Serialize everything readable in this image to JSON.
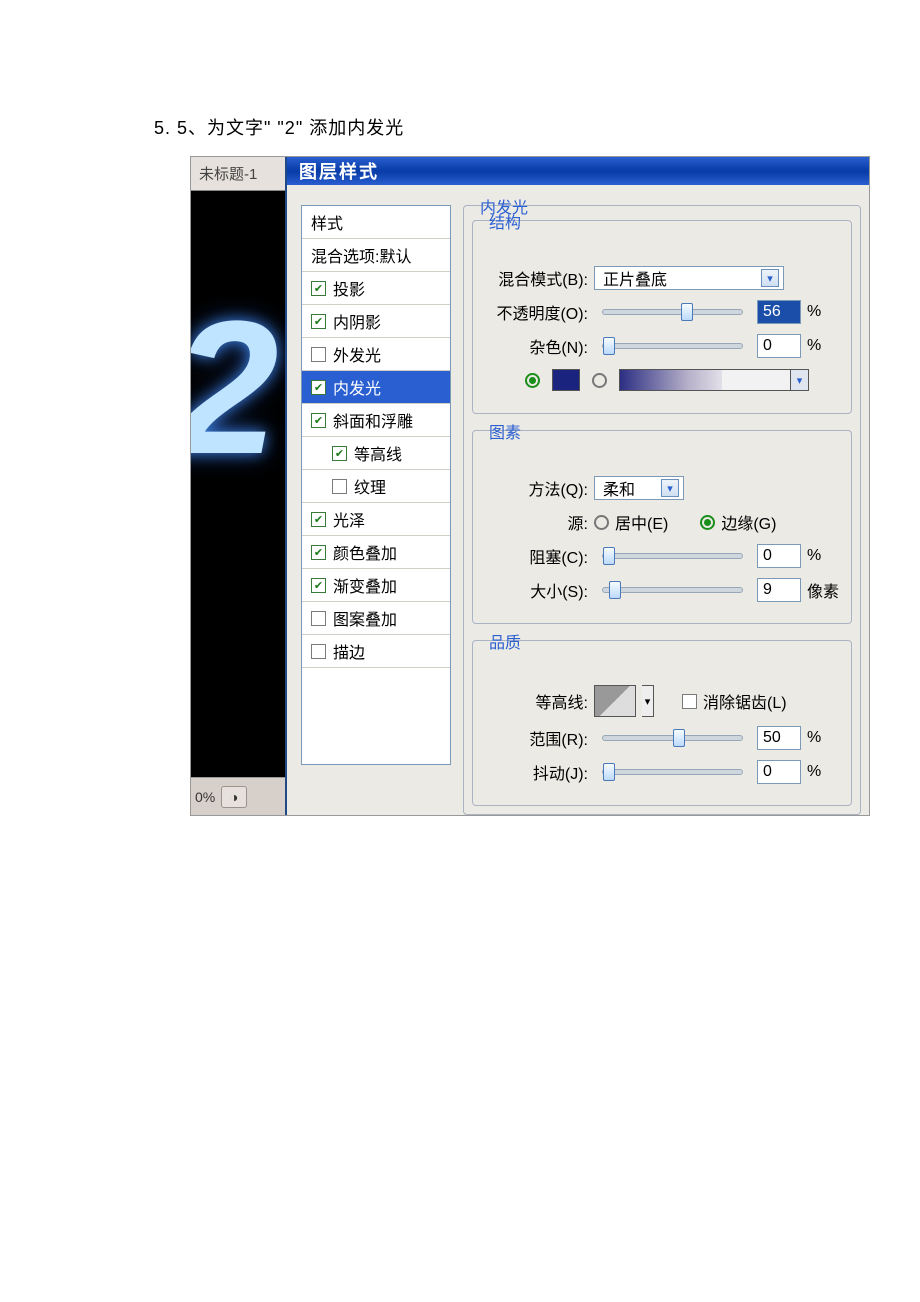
{
  "caption": "5. 5、为文字\" \"2\" 添加内发光",
  "canvas": {
    "doc_tab": "未标题-1",
    "zoom": "0%"
  },
  "dialog": {
    "title": "图层样式",
    "styles_header": "样式",
    "blend_defaults": "混合选项:默认",
    "items": [
      {
        "label": "投影",
        "checked": true,
        "selected": false
      },
      {
        "label": "内阴影",
        "checked": true,
        "selected": false
      },
      {
        "label": "外发光",
        "checked": false,
        "selected": false
      },
      {
        "label": "内发光",
        "checked": true,
        "selected": true
      },
      {
        "label": "斜面和浮雕",
        "checked": true,
        "selected": false
      },
      {
        "label": "等高线",
        "checked": true,
        "selected": false,
        "indent": true
      },
      {
        "label": "纹理",
        "checked": false,
        "selected": false,
        "indent": true
      },
      {
        "label": "光泽",
        "checked": true,
        "selected": false
      },
      {
        "label": "颜色叠加",
        "checked": true,
        "selected": false
      },
      {
        "label": "渐变叠加",
        "checked": true,
        "selected": false
      },
      {
        "label": "图案叠加",
        "checked": false,
        "selected": false
      },
      {
        "label": "描边",
        "checked": false,
        "selected": false
      }
    ],
    "panel_title": "内发光",
    "groups": {
      "structure": {
        "title": "结构",
        "blend_mode_label": "混合模式(B):",
        "blend_mode_value": "正片叠底",
        "opacity_label": "不透明度(O):",
        "opacity_value": "56",
        "opacity_unit": "%",
        "noise_label": "杂色(N):",
        "noise_value": "0",
        "noise_unit": "%",
        "color_hex": "#1a237e"
      },
      "elements": {
        "title": "图素",
        "method_label": "方法(Q):",
        "method_value": "柔和",
        "source_label": "源:",
        "source_center": "居中(E)",
        "source_edge": "边缘(G)",
        "choke_label": "阻塞(C):",
        "choke_value": "0",
        "choke_unit": "%",
        "size_label": "大小(S):",
        "size_value": "9",
        "size_unit": "像素"
      },
      "quality": {
        "title": "品质",
        "contour_label": "等高线:",
        "antialias_label": "消除锯齿(L)",
        "range_label": "范围(R):",
        "range_value": "50",
        "range_unit": "%",
        "jitter_label": "抖动(J):",
        "jitter_value": "0",
        "jitter_unit": "%"
      }
    }
  }
}
